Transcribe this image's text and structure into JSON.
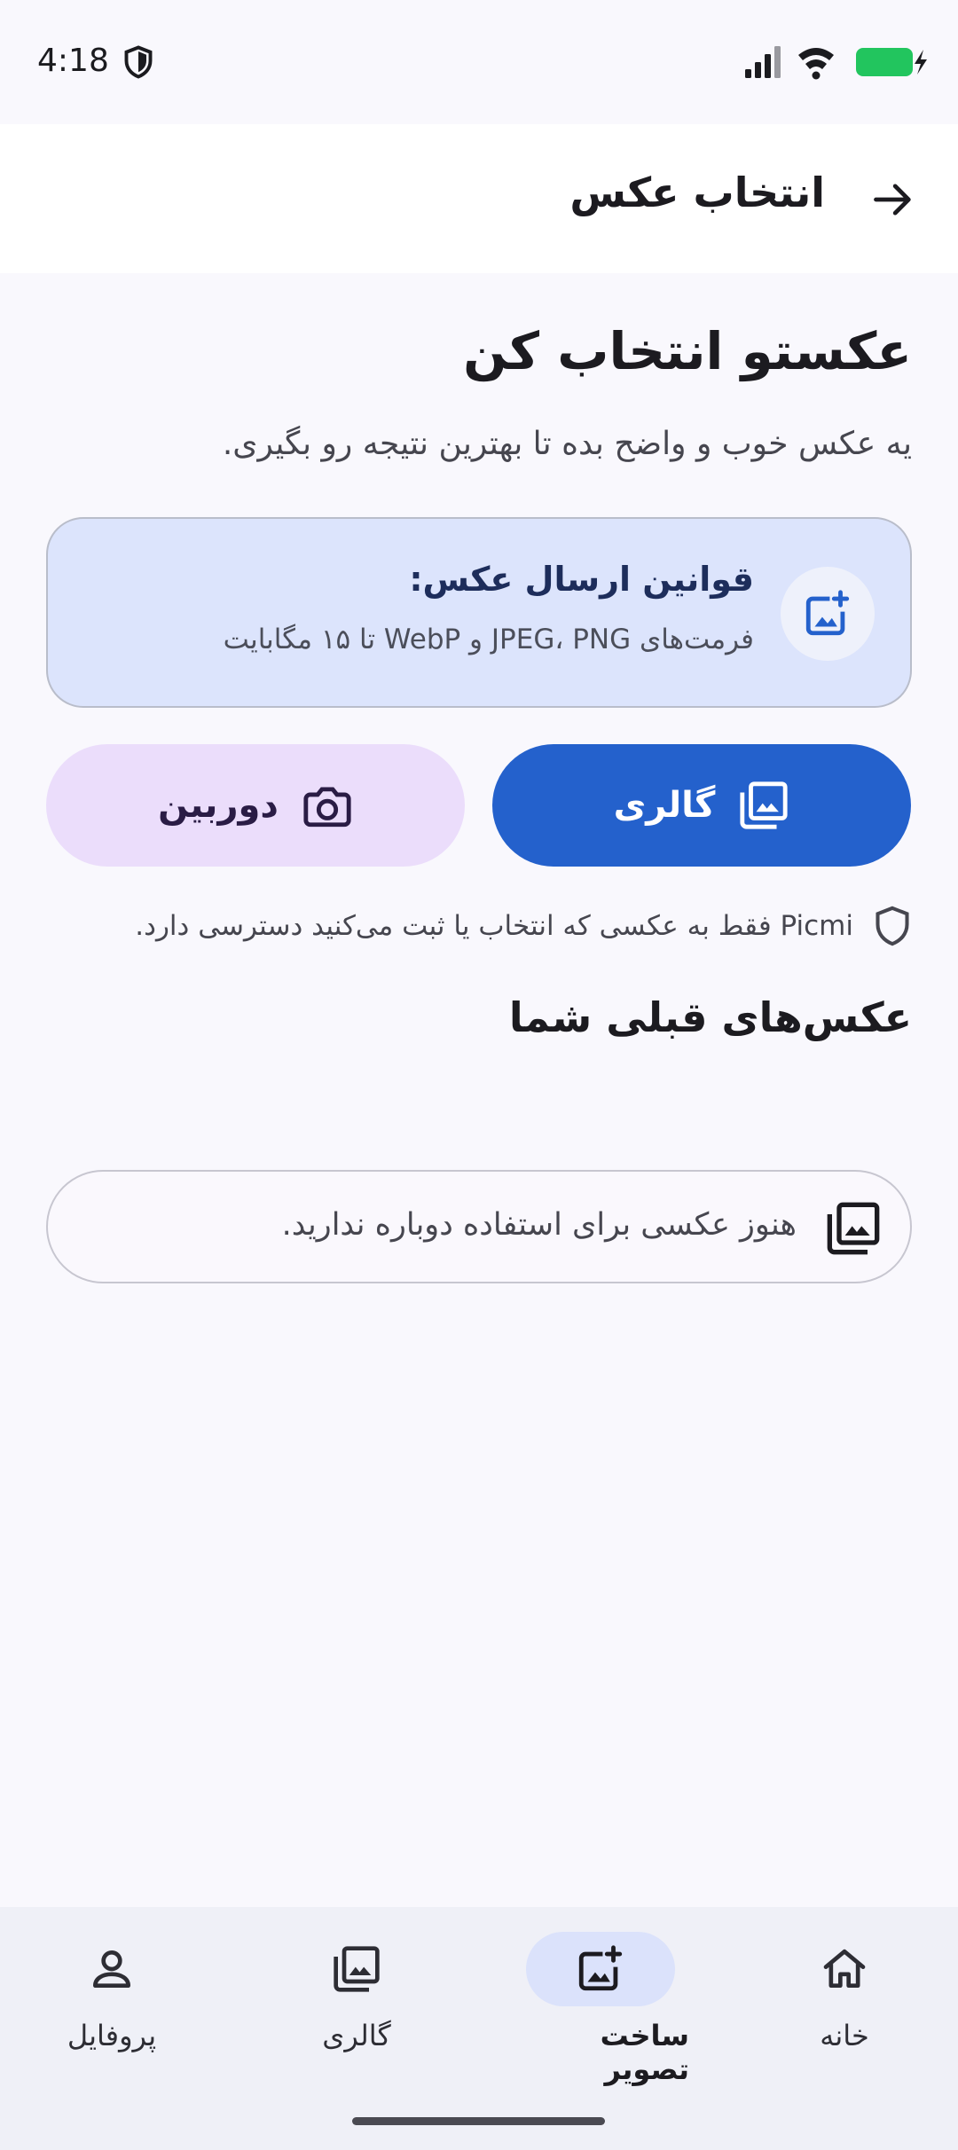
{
  "status_bar": {
    "time": "4:18"
  },
  "top_bar": {
    "title": "انتخاب عکس"
  },
  "main": {
    "heading": "عکستو انتخاب کن",
    "subtitle": "یه عکس خوب و واضح بده تا بهترین نتیجه رو بگیری.",
    "rules_card": {
      "title": "قوانین ارسال عکس:",
      "description": "فرمت‌های JPEG، PNG و WebP تا ۱۵ مگابایت"
    },
    "buttons": {
      "gallery_label": "گالری",
      "camera_label": "دوربین"
    },
    "privacy_note": "Picmi فقط به عکسی که انتخاب یا ثبت می‌کنید دسترسی دارد.",
    "previous_heading": "عکس‌های قبلی شما",
    "empty_message": "هنوز عکسی برای استفاده دوباره ندارید."
  },
  "bottom_nav": {
    "items": [
      {
        "label": "خانه",
        "icon": "home-icon"
      },
      {
        "label": "ساخت تصویر",
        "icon": "add-photo-icon",
        "active": true
      },
      {
        "label": "گالری",
        "icon": "photo-library-icon"
      },
      {
        "label": "پروفایل",
        "icon": "person-icon"
      }
    ]
  },
  "colors": {
    "primary": "#2461cc",
    "rules_card_bg": "#dce4fc",
    "camera_button_bg": "#ebddfb",
    "battery": "#22c55e"
  }
}
